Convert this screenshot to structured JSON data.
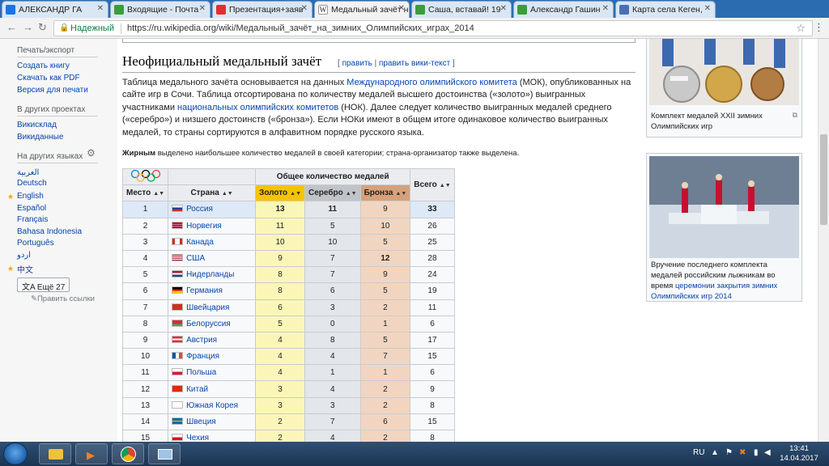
{
  "tabs": [
    {
      "title": "АЛЕКСАНДР ГА",
      "color": "#1a73e8"
    },
    {
      "title": "Входящие - Почта",
      "color": "#3a9d3a"
    },
    {
      "title": "Презентация+заяв",
      "color": "#e03030"
    },
    {
      "title": "Медальный зачёт н",
      "color": "#666666"
    },
    {
      "title": "Саша, вставай! 19",
      "color": "#3a9d3a"
    },
    {
      "title": "Александр Гашин",
      "color": "#3a9d3a"
    },
    {
      "title": "Карта села Кеген,",
      "color": "#4a6fb5"
    }
  ],
  "address": {
    "secure_label": "Надежный",
    "url": "https://ru.wikipedia.org/wiki/Медальный_зачёт_на_зимних_Олимпийских_играх_2014"
  },
  "sidebar": {
    "print_head": "Печать/экспорт",
    "print_links": [
      "Создать книгу",
      "Скачать как PDF",
      "Версия для печати"
    ],
    "projects_head": "В других проектах",
    "project_links": [
      "Викисклад",
      "Викиданные"
    ],
    "lang_head": "На других языках",
    "languages": [
      "العربية",
      "Deutsch",
      "English",
      "Español",
      "Français",
      "Bahasa Indonesia",
      "Português",
      "اردو",
      "中文"
    ],
    "more_label": "文A Ещё 27",
    "edit_links": "Править ссылки"
  },
  "article": {
    "heading": "Неофициальный медальный зачёт",
    "edit_open": "[ ",
    "edit": "править",
    "edit_sep": " | ",
    "edit_wiki": "править вики-текст",
    "edit_close": " ]",
    "p1": "Таблица медального зачёта основывается на данных ",
    "p1_link": "Международного олимпийского комитета",
    "p2": " (МОК), опубликованных на сайте игр в Сочи. Таблица отсортирована по количеству медалей высшего достоинства («золото») выигранных участниками ",
    "p2_link": "национальных олимпийских комитетов",
    "p3": " (НОК). Далее следует количество выигранных медалей среднего («серебро») и низшего достоинств («бронза»). Если НОКи имеют в общем итоге одинаковое количество выигранных медалей, то страны сортируются в алфавитном порядке русского языка.",
    "note_bold": "Жирным",
    "note_rest": " выделено наибольшее количество медалей в своей категории; страна-организатор также выделена."
  },
  "table": {
    "header_total_medals": "Общее количество медалей",
    "col_place": "Место",
    "col_country": "Страна",
    "col_gold": "Золото",
    "col_silver": "Серебро",
    "col_bronze": "Бронза",
    "col_total": "Всего",
    "rows": [
      {
        "place": "1",
        "country": "Россия",
        "gold": "13",
        "silver": "11",
        "bronze": "9",
        "total": "33"
      },
      {
        "place": "2",
        "country": "Норвегия",
        "gold": "11",
        "silver": "5",
        "bronze": "10",
        "total": "26"
      },
      {
        "place": "3",
        "country": "Канада",
        "gold": "10",
        "silver": "10",
        "bronze": "5",
        "total": "25"
      },
      {
        "place": "4",
        "country": "США",
        "gold": "9",
        "silver": "7",
        "bronze": "12",
        "total": "28"
      },
      {
        "place": "5",
        "country": "Нидерланды",
        "gold": "8",
        "silver": "7",
        "bronze": "9",
        "total": "24"
      },
      {
        "place": "6",
        "country": "Германия",
        "gold": "8",
        "silver": "6",
        "bronze": "5",
        "total": "19"
      },
      {
        "place": "7",
        "country": "Швейцария",
        "gold": "6",
        "silver": "3",
        "bronze": "2",
        "total": "11"
      },
      {
        "place": "8",
        "country": "Белоруссия",
        "gold": "5",
        "silver": "0",
        "bronze": "1",
        "total": "6"
      },
      {
        "place": "9",
        "country": "Австрия",
        "gold": "4",
        "silver": "8",
        "bronze": "5",
        "total": "17"
      },
      {
        "place": "10",
        "country": "Франция",
        "gold": "4",
        "silver": "4",
        "bronze": "7",
        "total": "15"
      },
      {
        "place": "11",
        "country": "Польша",
        "gold": "4",
        "silver": "1",
        "bronze": "1",
        "total": "6"
      },
      {
        "place": "12",
        "country": "Китай",
        "gold": "3",
        "silver": "4",
        "bronze": "2",
        "total": "9"
      },
      {
        "place": "13",
        "country": "Южная Корея",
        "gold": "3",
        "silver": "3",
        "bronze": "2",
        "total": "8"
      },
      {
        "place": "14",
        "country": "Швеция",
        "gold": "2",
        "silver": "7",
        "bronze": "6",
        "total": "15"
      },
      {
        "place": "15",
        "country": "Чехия",
        "gold": "2",
        "silver": "4",
        "bronze": "2",
        "total": "8"
      }
    ]
  },
  "images": {
    "caption1": "Комплект медалей XXII зимних Олимпийских игр",
    "caption2_a": "Вручение последнего комплекта медалей российским лыжникам во время ",
    "caption2_link": "церемонии закрытия зимних Олимпийских игр 2014"
  },
  "taskbar": {
    "lang": "RU",
    "time": "13:41",
    "date": "14.04.2017"
  },
  "colors": {
    "gold": "#f5c400",
    "silver": "#c0c4c8",
    "bronze": "#d6a17a",
    "link": "#0645ad"
  }
}
